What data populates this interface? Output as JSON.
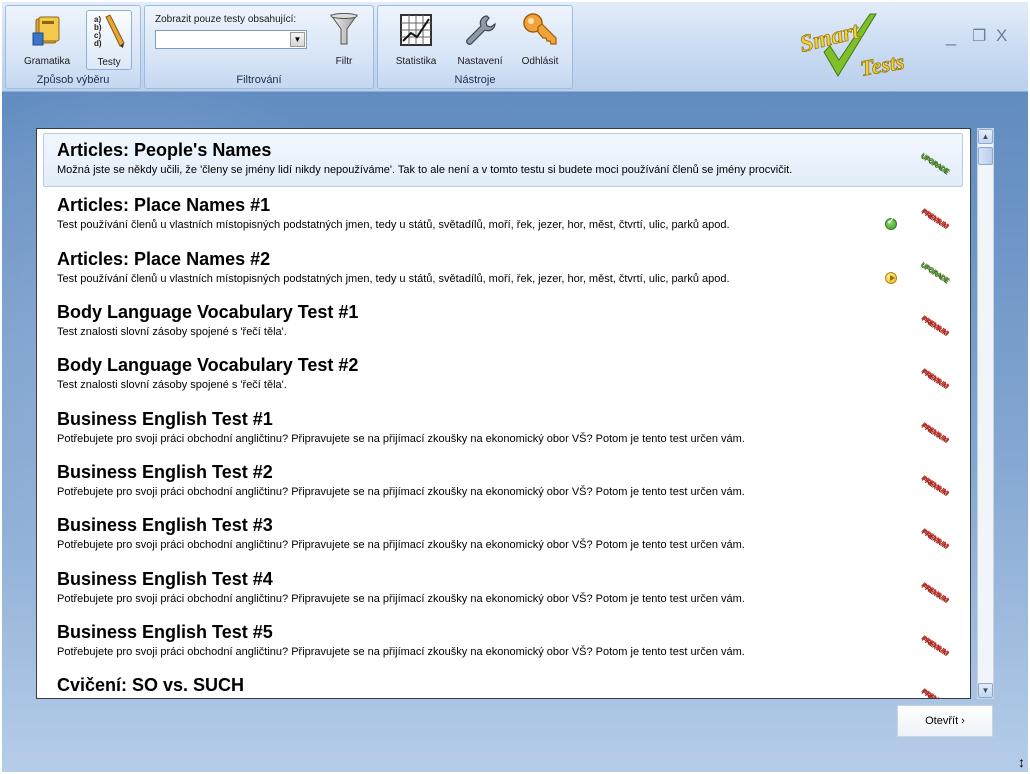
{
  "ribbon": {
    "selection_group": {
      "label": "Způsob výběru",
      "buttons": [
        {
          "label": "Gramatika",
          "icon": "book-icon"
        },
        {
          "label": "Testy",
          "icon": "test-list-icon"
        }
      ]
    },
    "filter_group": {
      "label": "Filtrování",
      "field_label": "Zobrazit pouze testy obsahující:",
      "field_value": "",
      "filter_button": "Filtr"
    },
    "tools_group": {
      "label": "Nástroje",
      "buttons": [
        {
          "label": "Statistika",
          "icon": "chart-icon"
        },
        {
          "label": "Nastavení",
          "icon": "wrench-icon"
        },
        {
          "label": "Odhlásit",
          "icon": "key-icon"
        }
      ]
    },
    "logo_text": [
      "Smart",
      "Tests"
    ]
  },
  "window_controls": {
    "minimize": "_",
    "maximize": "❐",
    "close": "X"
  },
  "tests": [
    {
      "title": "Articles: People's Names",
      "desc": "Možná jste se někdy učili, že 'členy se jmény lidí nikdy nepoužíváme'. Tak to ale není a v tomto testu si budete moci používání členů se jmény procvičit.",
      "status": "",
      "badge": "UPGRADE",
      "badge_color": "green"
    },
    {
      "title": "Articles: Place Names #1",
      "desc": "Test používání členů u vlastních místopisných podstatných jmen, tedy u států, světadílů, moří, řek, jezer, hor, měst, čtvrtí, ulic, parků apod.",
      "status": "completed",
      "badge": "PREMIUM",
      "badge_color": "red"
    },
    {
      "title": "Articles: Place Names #2",
      "desc": "Test používání členů u vlastních místopisných podstatných jmen, tedy u států, světadílů, moří, řek, jezer, hor, měst, čtvrtí, ulic, parků apod.",
      "status": "in-progress",
      "badge": "UPGRADE",
      "badge_color": "green"
    },
    {
      "title": "Body Language Vocabulary Test #1",
      "desc": "Test znalosti slovní zásoby spojené s 'řečí těla'.",
      "status": "",
      "badge": "PREMIUM",
      "badge_color": "red"
    },
    {
      "title": "Body Language Vocabulary Test #2",
      "desc": "Test znalosti slovní zásoby spojené s 'řečí těla'.",
      "status": "",
      "badge": "PREMIUM",
      "badge_color": "red"
    },
    {
      "title": "Business English Test #1",
      "desc": "Potřebujete pro svoji práci obchodní angličtinu? Připravujete se na přijímací zkoušky na ekonomický obor VŠ? Potom je tento test určen vám.",
      "status": "",
      "badge": "PREMIUM",
      "badge_color": "red"
    },
    {
      "title": "Business English Test #2",
      "desc": "Potřebujete pro svoji práci obchodní angličtinu? Připravujete se na přijímací zkoušky na ekonomický obor VŠ? Potom je tento test určen vám.",
      "status": "",
      "badge": "PREMIUM",
      "badge_color": "red"
    },
    {
      "title": "Business English Test #3",
      "desc": "Potřebujete pro svoji práci obchodní angličtinu? Připravujete se na přijímací zkoušky na ekonomický obor VŠ? Potom je tento test určen vám.",
      "status": "",
      "badge": "PREMIUM",
      "badge_color": "red"
    },
    {
      "title": "Business English Test #4",
      "desc": "Potřebujete pro svoji práci obchodní angličtinu? Připravujete se na přijímací zkoušky na ekonomický obor VŠ? Potom je tento test určen vám.",
      "status": "",
      "badge": "PREMIUM",
      "badge_color": "red"
    },
    {
      "title": "Business English Test #5",
      "desc": "Potřebujete pro svoji práci obchodní angličtinu? Připravujete se na přijímací zkoušky na ekonomický obor VŠ? Potom je tento test určen vám.",
      "status": "",
      "badge": "PREMIUM",
      "badge_color": "red"
    },
    {
      "title": "Cvičení: SO vs. SUCH",
      "desc": "",
      "status": "",
      "badge": "PREMIUM",
      "badge_color": "red"
    }
  ],
  "open_button": "Otevřít ›",
  "colors": {
    "accent": "#5a87bd",
    "badge_red": "#c8261b",
    "badge_green": "#4f8a2a"
  }
}
